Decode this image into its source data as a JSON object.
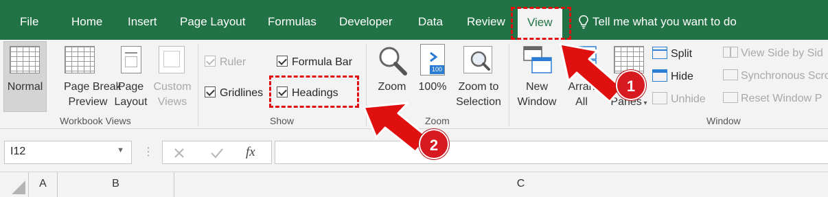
{
  "tabs": {
    "file": "File",
    "home": "Home",
    "insert": "Insert",
    "page_layout": "Page Layout",
    "formulas": "Formulas",
    "developer": "Developer",
    "data": "Data",
    "review": "Review",
    "view": "View"
  },
  "tell_me": "Tell me what you want to do",
  "workbook_views": {
    "normal": "Normal",
    "page_break_1": "Page Break",
    "page_break_2": "Preview",
    "page_layout_1": "Page",
    "page_layout_2": "Layout",
    "custom_1": "Custom",
    "custom_2": "Views",
    "group_label": "Workbook Views"
  },
  "show": {
    "ruler": "Ruler",
    "formula_bar": "Formula Bar",
    "gridlines": "Gridlines",
    "headings": "Headings",
    "group_label": "Show"
  },
  "zoom": {
    "zoom": "Zoom",
    "hundred": "100%",
    "hundred_icon_text": "100",
    "zoom_to_1": "Zoom to",
    "zoom_to_2": "Selection",
    "group_label": "Zoom"
  },
  "window": {
    "new_1": "New",
    "new_2": "Window",
    "arrange_1": "Arran",
    "arrange_2": "All",
    "freeze_1": "F",
    "freeze_2": "Panes",
    "split": "Split",
    "hide": "Hide",
    "unhide": "Unhide",
    "view_side": "View Side by Sid",
    "sync_scroll": "Synchronous Scro",
    "reset_pos": "Reset Window P",
    "group_label": "Window"
  },
  "formula_bar": {
    "name_box": "I12",
    "fx": "fx"
  },
  "columns": [
    "A",
    "B",
    "C"
  ],
  "annotations": {
    "badge_1": "1",
    "badge_2": "2"
  },
  "colors": {
    "ribbon_green": "#217346",
    "annotation_red": "#e01010"
  }
}
